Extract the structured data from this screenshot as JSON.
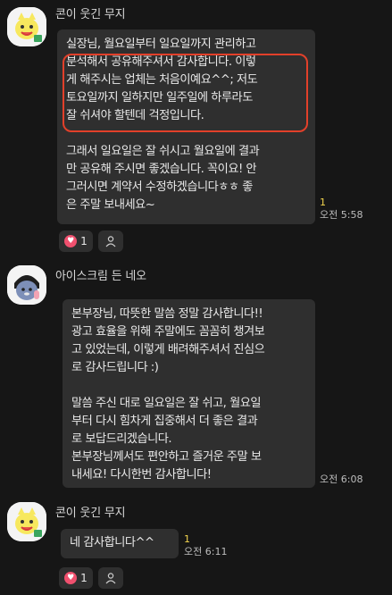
{
  "messages": [
    {
      "sender": "콘이 웃긴 무지",
      "lines_a": [
        "실장님, 월요일부터 일요일까지 관리하고",
        "분석해서 공유해주셔서 감사합니다. 이렇",
        "게 해주시는 업체는 처음이예요^^; 저도",
        "토요일까지 일하지만 일주일에 하루라도",
        "잘 쉬셔야 할텐데 걱정입니다."
      ],
      "lines_b": [
        "그래서 일요일은 잘 쉬시고 월요일에 결과",
        "만 공유해 주시면 좋겠습니다. 꼭이요! 안",
        "그러시면 계약서 수정하겠습니다ㅎㅎ 좋",
        "은 주말 보내세요~"
      ],
      "unread": "1",
      "time": "오전 5:58",
      "reaction_count": "1"
    },
    {
      "sender": "아이스크림 든 네오",
      "lines_a": [
        "본부장님, 따뜻한 말씀 정말 감사합니다!!",
        "광고 효율을 위해 주말에도 꼼꼼히 챙겨보",
        "고 있었는데, 이렇게 배려해주셔서 진심으",
        "로 감사드립니다 :)"
      ],
      "lines_b": [
        "말씀 주신 대로 일요일은 잘 쉬고, 월요일",
        "부터 다시 힘차게 집중해서 더 좋은 결과",
        "로 보답드리겠습니다.",
        "본부장님께서도 편안하고 즐거운 주말 보",
        "내세요! 다시한번 감사합니다!"
      ],
      "unread": "",
      "time": "오전 6:08"
    },
    {
      "sender": "콘이 웃긴 무지",
      "text": "네 감사합니다^^",
      "unread": "1",
      "time": "오전 6:11",
      "reaction_count": "1"
    }
  ],
  "icons": {
    "heart": "heart-icon",
    "person": "person-icon",
    "avatar_muzi": "muzi-avatar",
    "avatar_neo": "neo-avatar"
  },
  "colors": {
    "background": "#161616",
    "bubble": "#2f2f2f",
    "highlight": "#e2402a",
    "unread": "#f3d54e",
    "heart": "#f0506e"
  }
}
